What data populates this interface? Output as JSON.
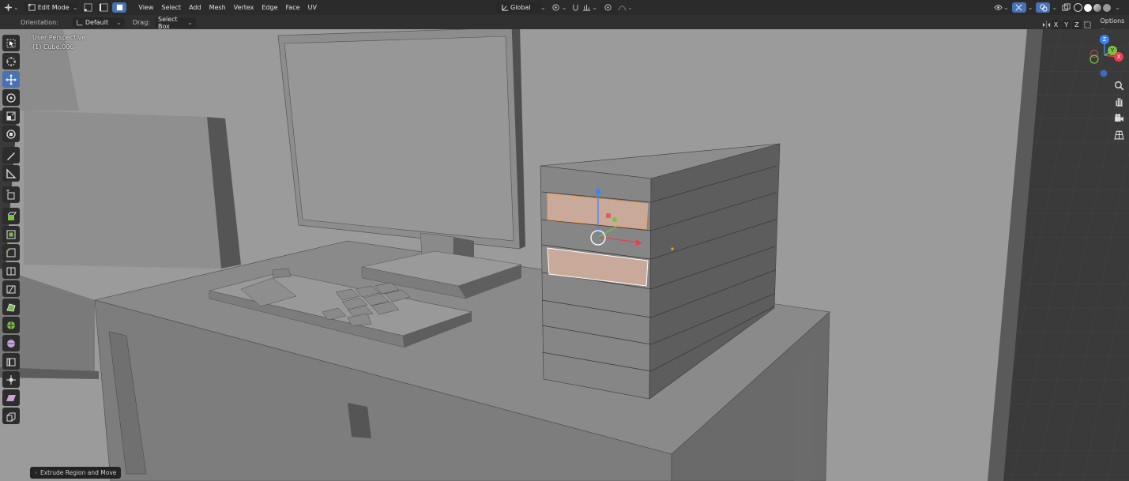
{
  "header": {
    "mode": "Edit Mode",
    "menus": [
      "View",
      "Select",
      "Add",
      "Mesh",
      "Vertex",
      "Edge",
      "Face",
      "UV"
    ],
    "transform_orientation": "Global"
  },
  "tool_settings": {
    "orientation_label": "Orientation:",
    "orientation_value": "Default",
    "drag_label": "Drag:",
    "drag_value": "Select Box",
    "axis_x": "X",
    "axis_y": "Y",
    "axis_z": "Z",
    "options_label": "Options"
  },
  "viewport": {
    "view_name": "User Perspective",
    "object_name": "(1) Cube.006"
  },
  "gizmo": {
    "x": "X",
    "y": "Y",
    "z": "Z"
  },
  "last_operator": "Extrude Region and Move",
  "colors": {
    "accent": "#4772b3",
    "selected_face": "#c9a99a",
    "axis_x": "#e8404f",
    "axis_y": "#7bc043",
    "axis_z": "#3b83f6"
  },
  "toolbar_icons": [
    "select-box-icon",
    "cursor-icon",
    "move-icon",
    "rotate-icon",
    "scale-icon",
    "transform-icon",
    "annotate-icon",
    "measure-icon",
    "add-cube-icon",
    "extrude-icon",
    "inset-icon",
    "bevel-icon",
    "loop-cut-icon",
    "knife-icon",
    "poly-build-icon",
    "spin-icon",
    "smooth-icon",
    "edge-slide-icon",
    "shrink-fatten-icon",
    "shear-icon",
    "rip-icon"
  ]
}
